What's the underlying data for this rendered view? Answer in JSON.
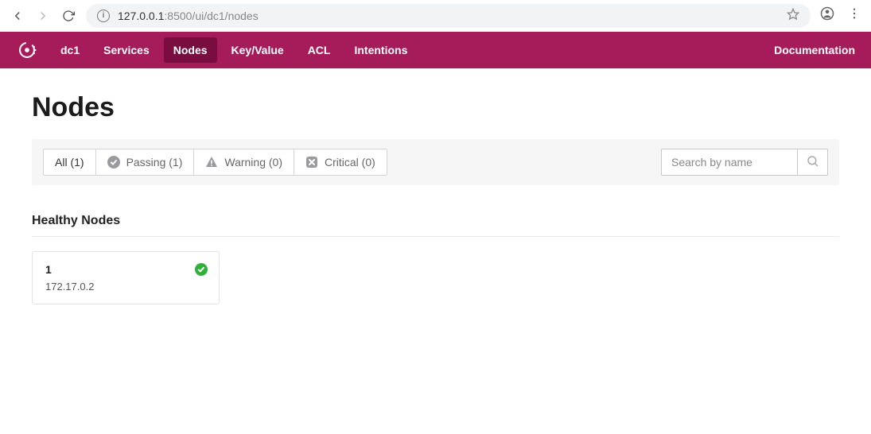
{
  "browser": {
    "address_host": "127.0.0.1",
    "address_path": ":8500/ui/dc1/nodes"
  },
  "nav": {
    "datacenter": "dc1",
    "items": [
      {
        "label": "Services",
        "active": false
      },
      {
        "label": "Nodes",
        "active": true
      },
      {
        "label": "Key/Value",
        "active": false
      },
      {
        "label": "ACL",
        "active": false
      },
      {
        "label": "Intentions",
        "active": false
      }
    ],
    "documentation": "Documentation"
  },
  "page": {
    "title": "Nodes",
    "filters": {
      "all_label": "All (1)",
      "passing_label": "Passing (1)",
      "warning_label": "Warning (0)",
      "critical_label": "Critical (0)"
    },
    "search_placeholder": "Search by name",
    "healthy_section_title": "Healthy Nodes",
    "healthy_nodes": [
      {
        "name": "1",
        "address": "172.17.0.2"
      }
    ]
  }
}
